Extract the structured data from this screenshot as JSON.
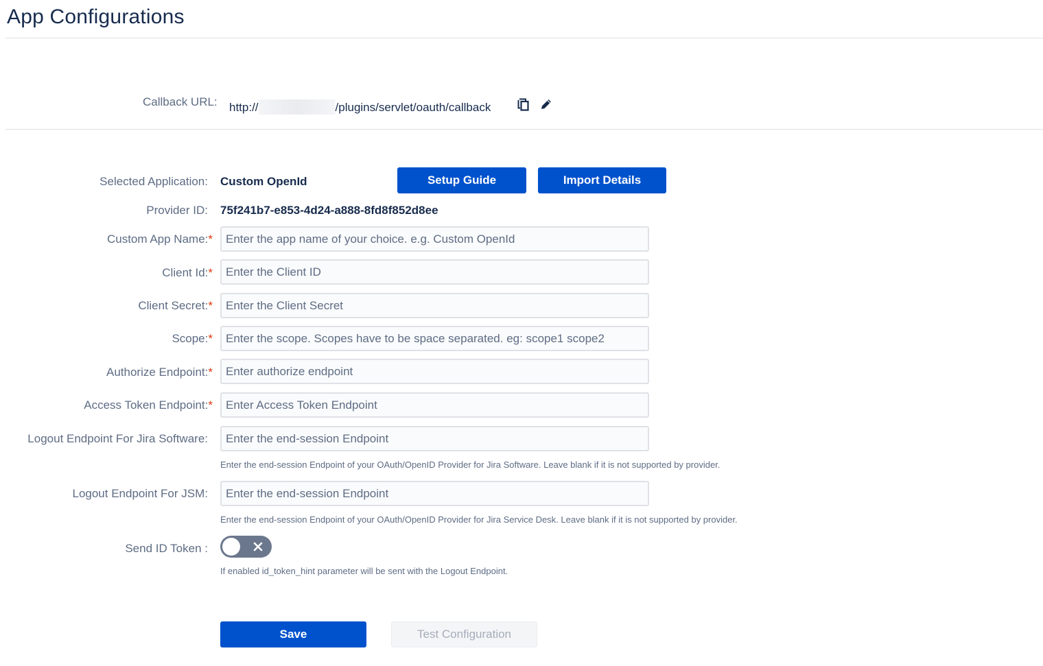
{
  "page": {
    "title": "App Configurations"
  },
  "callback": {
    "label": "Callback URL:",
    "url_prefix": "http://",
    "url_suffix": "/plugins/servlet/oauth/callback",
    "copy_icon": "copy-icon",
    "edit_icon": "pencil-icon"
  },
  "app": {
    "selected_label": "Selected Application:",
    "selected_value": "Custom OpenId",
    "setup_guide_label": "Setup Guide",
    "import_details_label": "Import Details",
    "provider_label": "Provider ID:",
    "provider_value": "75f241b7-e853-4d24-a888-8fd8f852d8ee"
  },
  "fields": {
    "custom_app_name": {
      "label": "Custom App Name:",
      "required": "*",
      "value": "",
      "placeholder": "Enter the app name of your choice. e.g. Custom OpenId"
    },
    "client_id": {
      "label": "Client Id:",
      "required": "*",
      "value": "",
      "placeholder": "Enter the Client ID"
    },
    "client_secret": {
      "label": "Client Secret:",
      "required": "*",
      "value": "",
      "placeholder": "Enter the Client Secret"
    },
    "scope": {
      "label": "Scope:",
      "required": "*",
      "value": "",
      "placeholder": "Enter the scope. Scopes have to be space separated. eg: scope1 scope2"
    },
    "authorize_endpoint": {
      "label": "Authorize Endpoint:",
      "required": "*",
      "value": "",
      "placeholder": "Enter authorize endpoint"
    },
    "access_token_endpoint": {
      "label": "Access Token Endpoint:",
      "required": "*",
      "value": "",
      "placeholder": "Enter Access Token Endpoint"
    },
    "logout_jira": {
      "label": "Logout Endpoint For Jira Software:",
      "value": "",
      "placeholder": "Enter the end-session Endpoint",
      "help": "Enter the end-session Endpoint of your OAuth/OpenID Provider for Jira Software. Leave blank if it is not supported by provider."
    },
    "logout_jsm": {
      "label": "Logout Endpoint For JSM:",
      "value": "",
      "placeholder": "Enter the end-session Endpoint",
      "help": "Enter the end-session Endpoint of your OAuth/OpenID Provider for Jira Service Desk. Leave blank if it is not supported by provider."
    }
  },
  "send_id_token": {
    "label": "Send ID Token :",
    "enabled": false,
    "help": "If enabled id_token_hint parameter will be sent with the Logout Endpoint.",
    "off_icon": "x-icon"
  },
  "actions": {
    "save_label": "Save",
    "test_label": "Test Configuration"
  },
  "colors": {
    "primary": "#0052cc",
    "required": "#de350b",
    "toggle_off": "#6b778c"
  }
}
